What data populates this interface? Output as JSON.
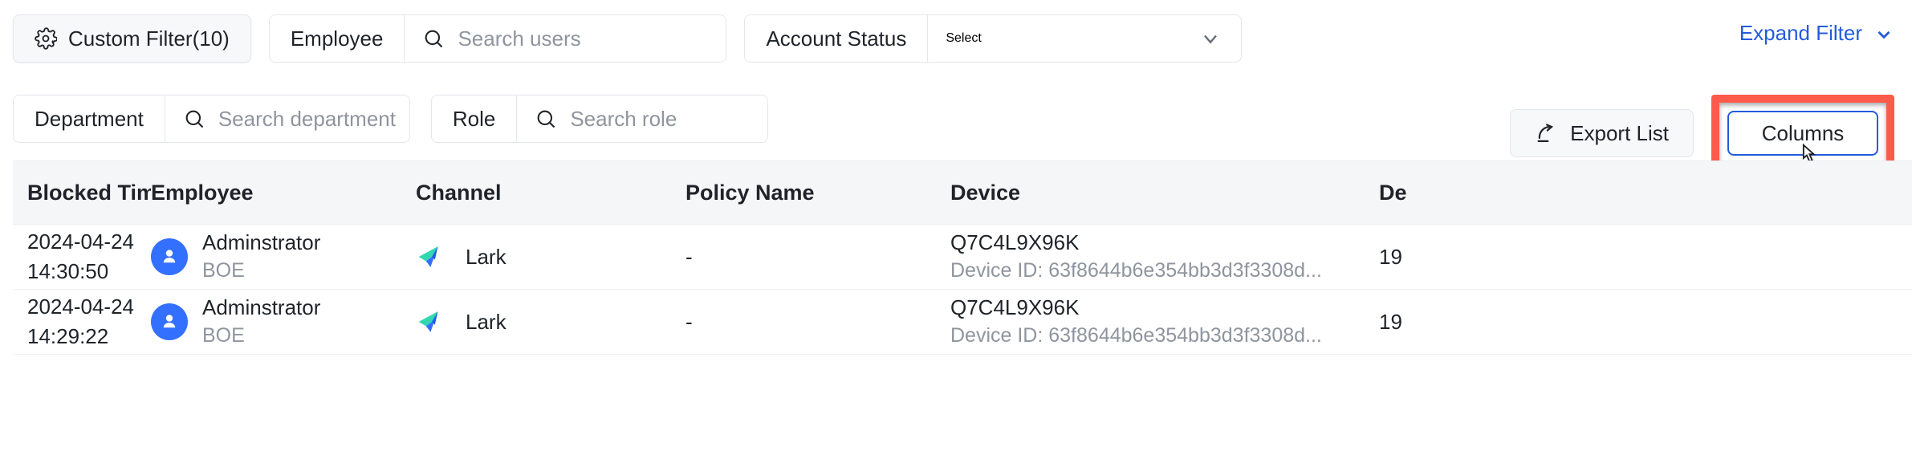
{
  "colors": {
    "accent_blue": "#245bdb",
    "avatar_blue": "#3370ff",
    "highlight_red": "#fc5b4b",
    "header_bg": "#f5f6f7",
    "muted_text": "#8f959e",
    "text": "#1f2329",
    "lark_teal": "#32d6b0",
    "lark_blue": "#3370ff"
  },
  "filters": {
    "custom_filter": {
      "label": "Custom Filter(10)",
      "icon": "gear-icon"
    },
    "employee": {
      "label": "Employee",
      "placeholder": "Search users",
      "icon": "search-icon",
      "value": ""
    },
    "account_status": {
      "label": "Account Status",
      "placeholder": "Select",
      "icon": "chevron-down-icon",
      "value": ""
    },
    "department": {
      "label": "Department",
      "placeholder": "Search department",
      "icon": "search-icon",
      "value": ""
    },
    "role": {
      "label": "Role",
      "placeholder": "Search role",
      "icon": "search-icon",
      "value": ""
    },
    "expand_filter": {
      "label": "Expand Filter",
      "icon": "chevron-down-icon"
    }
  },
  "actions": {
    "export": {
      "label": "Export List",
      "icon": "share-export-icon"
    },
    "columns": {
      "label": "Columns",
      "highlighted": true
    }
  },
  "table": {
    "headers": [
      "Blocked Time",
      "Employee",
      "Channel",
      "Policy Name",
      "Device",
      "De"
    ],
    "rows": [
      {
        "blocked_time_date": "2024-04-24",
        "blocked_time_time": "14:30:50",
        "employee_name": "Adminstrator",
        "employee_org": "BOE",
        "employee_avatar": "user-avatar-icon",
        "channel_name": "Lark",
        "channel_icon": "lark-logo-icon",
        "policy_name": "-",
        "device_name": "Q7C4L9X96K",
        "device_id": "Device ID: 63f8644b6e354bb3d3f3308d...",
        "last_col": "19"
      },
      {
        "blocked_time_date": "2024-04-24",
        "blocked_time_time": "14:29:22",
        "employee_name": "Adminstrator",
        "employee_org": "BOE",
        "employee_avatar": "user-avatar-icon",
        "channel_name": "Lark",
        "channel_icon": "lark-logo-icon",
        "policy_name": "-",
        "device_name": "Q7C4L9X96K",
        "device_id": "Device ID: 63f8644b6e354bb3d3f3308d...",
        "last_col": "19"
      }
    ]
  }
}
